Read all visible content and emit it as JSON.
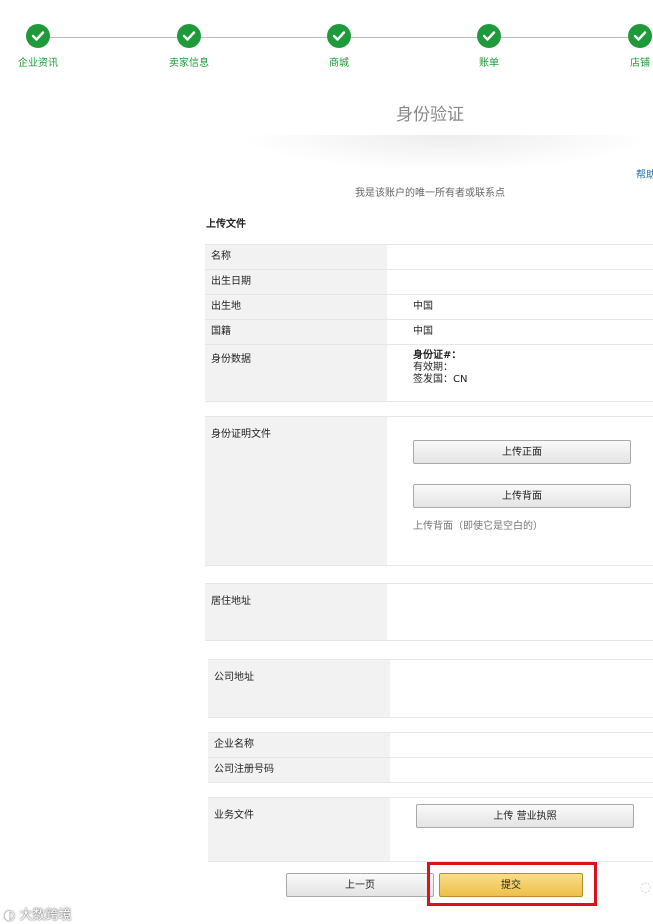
{
  "progress": {
    "steps": [
      {
        "label": "企业资讯",
        "completed": true
      },
      {
        "label": "卖家信息",
        "completed": true
      },
      {
        "label": "商城",
        "completed": true
      },
      {
        "label": "账单",
        "completed": true
      },
      {
        "label": "店铺",
        "completed": true
      }
    ]
  },
  "page": {
    "title": "身份验证",
    "help_link": "帮助",
    "subtitle": "我是该账户的唯一所有者或联系点",
    "section_title": "上传文件"
  },
  "fields": {
    "name": {
      "label": "名称",
      "value": ""
    },
    "birth_date": {
      "label": "出生日期",
      "value": ""
    },
    "birth_place": {
      "label": "出生地",
      "value": "中国"
    },
    "nationality": {
      "label": "国籍",
      "value": "中国"
    },
    "id_data": {
      "label": "身份数据",
      "id_number_label": "身份证#：",
      "expiry_label": "有效期：",
      "issuing_country": "签发国：CN"
    }
  },
  "id_document": {
    "label": "身份证明文件",
    "upload_front": "上传正面",
    "upload_back": "上传背面",
    "hint": "上传背面（即使它是空白的）"
  },
  "residence": {
    "label": "居住地址"
  },
  "company_address": {
    "label": "公司地址"
  },
  "company": {
    "name_label": "企业名称",
    "reg_number_label": "公司注册号码"
  },
  "business_docs": {
    "label": "业务文件",
    "upload_license": "上传 营业执照"
  },
  "footer": {
    "prev_button": "上一页",
    "submit_button": "提交"
  },
  "watermark": {
    "text": "大数跨境"
  },
  "colors": {
    "step_green": "#1f9a3a",
    "link_blue": "#1a6eb5",
    "submit_yellow": "#edc048",
    "highlight_red": "#e0101a"
  }
}
